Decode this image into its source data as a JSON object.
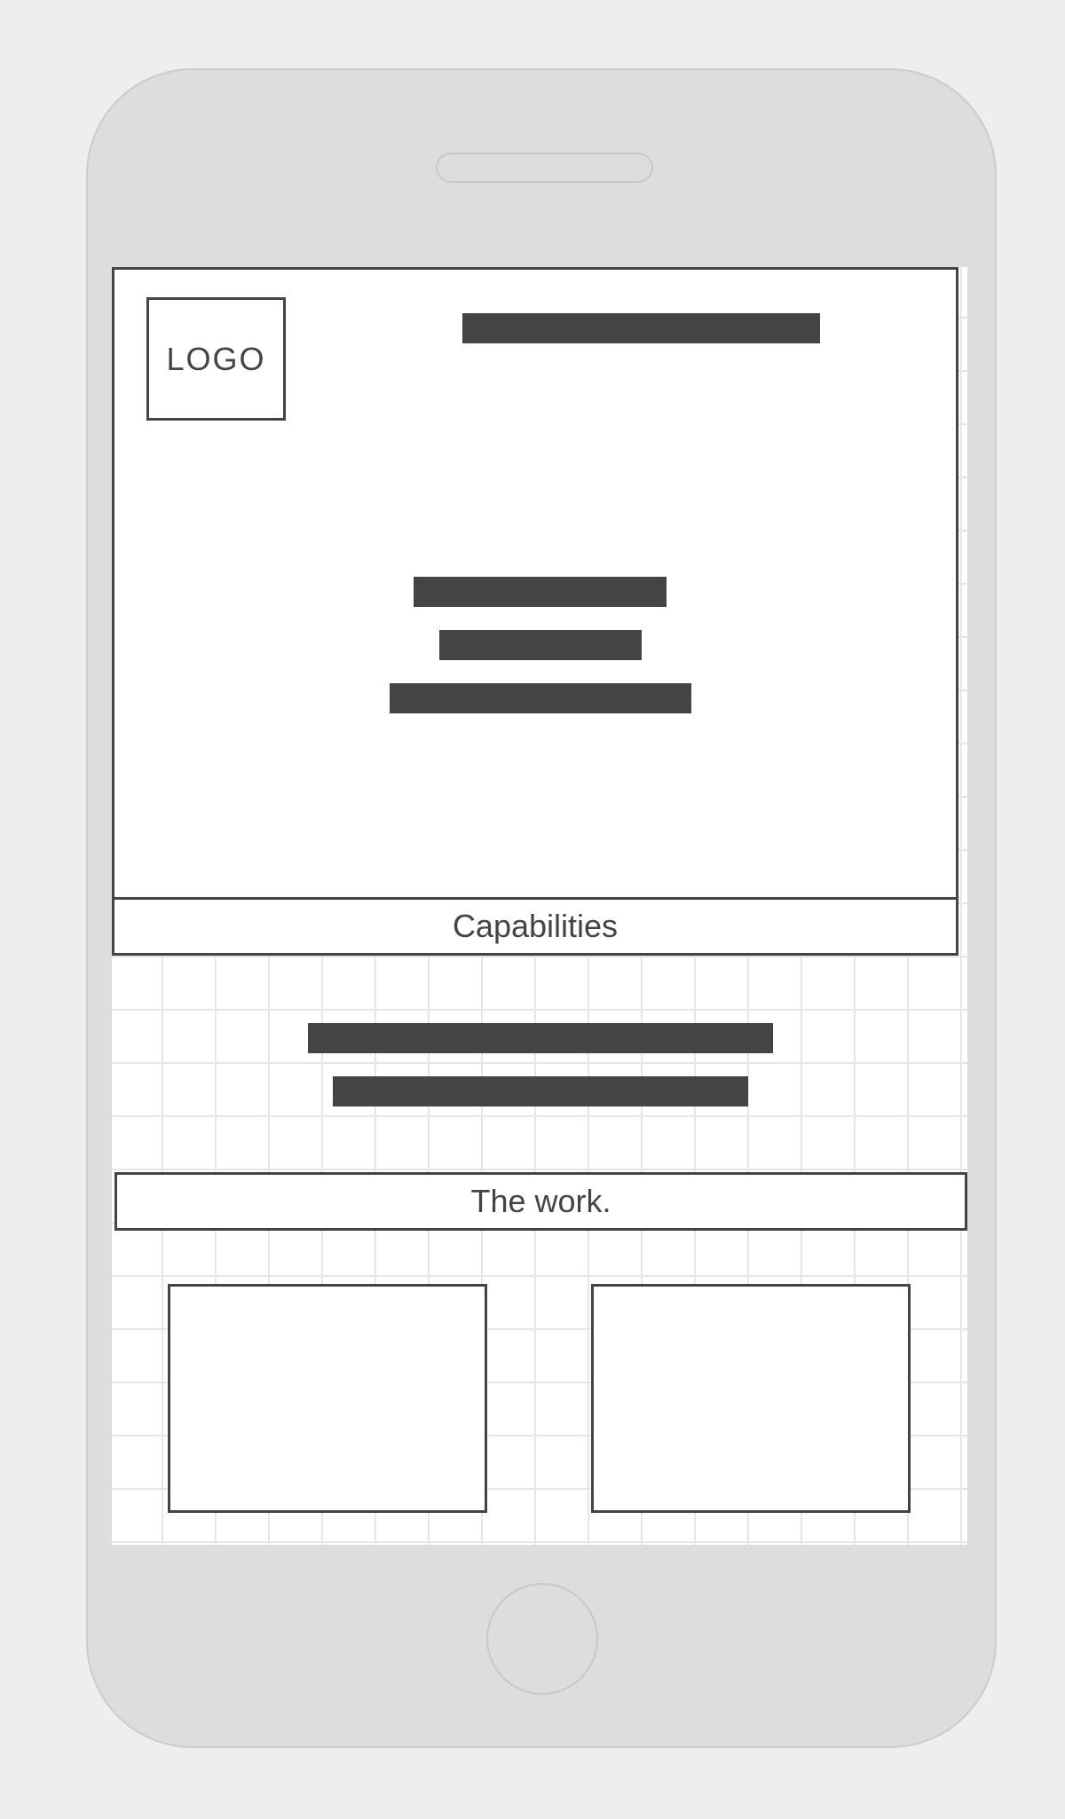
{
  "device": {
    "frame_color": "#dddddd",
    "outline_color": "#cccccc"
  },
  "hero": {
    "logo_label": "LOGO",
    "nav_placeholder": "text-bar",
    "headline_placeholders": [
      "text-bar",
      "text-bar",
      "text-bar"
    ]
  },
  "capabilities": {
    "title": "Capabilities",
    "text_placeholders": [
      "text-bar",
      "text-bar"
    ]
  },
  "work": {
    "title": "The work.",
    "cards": [
      "image-placeholder",
      "image-placeholder"
    ]
  },
  "colors": {
    "ink": "#444444",
    "grid": "#e6e6e6",
    "background": "#eeeeee"
  }
}
